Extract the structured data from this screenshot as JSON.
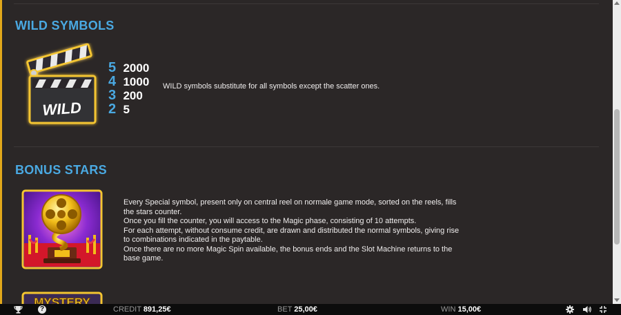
{
  "wild": {
    "title": "WILD SYMBOLS",
    "symbol_text": "WILD",
    "payouts": [
      {
        "count": "5",
        "value": "2000"
      },
      {
        "count": "4",
        "value": "1000"
      },
      {
        "count": "3",
        "value": "200"
      },
      {
        "count": "2",
        "value": "5"
      }
    ],
    "description": "WILD symbols substitute for all symbols except the scatter ones."
  },
  "bonus": {
    "title": "BONUS STARS",
    "lines": [
      "Every Special symbol, present only on central reel on normale game mode, sorted on the reels, fills",
      "the stars counter.",
      "Once you fill the counter, you will access to the Magic phase, consisting of 10 attempts.",
      "For each attempt, without consume credit, are drawn and distributed the normal symbols, giving rise",
      "to combinations indicated in the paytable.",
      "Once there are no more Magic Spin available, the bonus ends and the Slot Machine returns to the",
      "base game."
    ]
  },
  "mystery": {
    "symbol_text": "MYSTERY"
  },
  "footer": {
    "credit_label": "CREDIT",
    "credit_value": "891,25€",
    "bet_label": "BET",
    "bet_value": "25,00€",
    "win_label": "WIN",
    "win_value": "15,00€",
    "help_text": "?"
  },
  "colors": {
    "accent": "#4aa9e2",
    "gold": "#e2a81b",
    "background": "#2b2727"
  },
  "icons": [
    "trophy-icon",
    "help-icon",
    "gear-icon",
    "sound-icon",
    "fullscreen-icon"
  ]
}
